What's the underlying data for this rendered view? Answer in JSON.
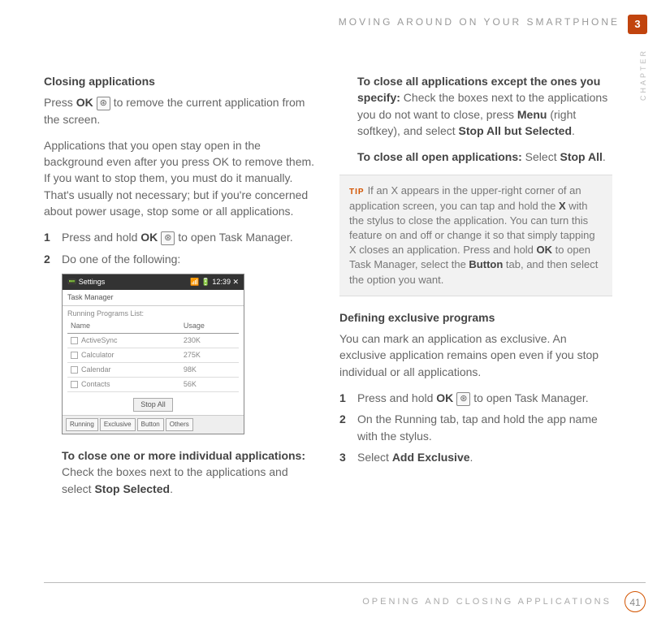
{
  "header": {
    "title": "MOVING AROUND ON YOUR SMARTPHONE",
    "chapter_number": "3",
    "chapter_label": "CHAPTER"
  },
  "left": {
    "heading": "Closing applications",
    "p1_pre": "Press ",
    "p1_bold": "OK",
    "p1_post": " to remove the current application from the screen.",
    "p2": "Applications that you open stay open in the background even after you press OK to remove them. If you want to stop them, you must do it manually. That's usually not necessary; but if you're concerned about power usage, stop some or all applications.",
    "step1_pre": "Press and hold ",
    "step1_bold": "OK",
    "step1_post": " to open Task Manager.",
    "step2": "Do one of the following:",
    "close_individual_bold": "To close one or more individual applications:",
    "close_individual_rest": " Check the boxes next to the applications and select ",
    "close_individual_action": "Stop Selected",
    "close_individual_period": "."
  },
  "screenshot": {
    "titlebar_left": "Settings",
    "titlebar_right": "12:39",
    "subtitle": "Task Manager",
    "running_label": "Running Programs List:",
    "col1": "Name",
    "col2": "Usage",
    "rows": [
      {
        "name": "ActiveSync",
        "usage": "230K"
      },
      {
        "name": "Calculator",
        "usage": "275K"
      },
      {
        "name": "Calendar",
        "usage": "98K"
      },
      {
        "name": "Contacts",
        "usage": "56K"
      }
    ],
    "stop_all_btn": "Stop All",
    "tabs": [
      "Running",
      "Exclusive",
      "Button",
      "Others"
    ]
  },
  "right": {
    "except_bold": "To close all applications except the ones you specify:",
    "except_rest1": " Check the boxes next to the applications you do not want to close, press ",
    "except_menu": "Menu",
    "except_rest2": " (right softkey), and select ",
    "except_action": "Stop All but Selected",
    "except_period": ".",
    "all_bold": "To close all open applications:",
    "all_rest": " Select ",
    "all_action": "Stop All",
    "all_period": ".",
    "tip_label": "TIP",
    "tip_t1": "If an X appears in the upper-right corner of an application screen, you can tap and hold the ",
    "tip_x": "X",
    "tip_t2": " with the stylus to close the application. You can turn this feature on and off or change it so that simply tapping X closes an application. Press and hold ",
    "tip_ok": "OK",
    "tip_t3": " to open Task Manager, select the ",
    "tip_button": "Button",
    "tip_t4": " tab, and then select the option you want.",
    "excl_heading": "Defining exclusive programs",
    "excl_p": "You can mark an application as exclusive. An exclusive application remains open even if you stop individual or all applications.",
    "excl_s1_pre": "Press and hold ",
    "excl_s1_bold": "OK",
    "excl_s1_post": " to open Task Manager.",
    "excl_s2": "On the Running tab, tap and hold the app name with the stylus.",
    "excl_s3_pre": "Select ",
    "excl_s3_bold": "Add Exclusive",
    "excl_s3_post": "."
  },
  "footer": {
    "text": "OPENING AND CLOSING APPLICATIONS",
    "page": "41"
  },
  "numbers": {
    "one": "1",
    "two": "2",
    "three": "3"
  }
}
